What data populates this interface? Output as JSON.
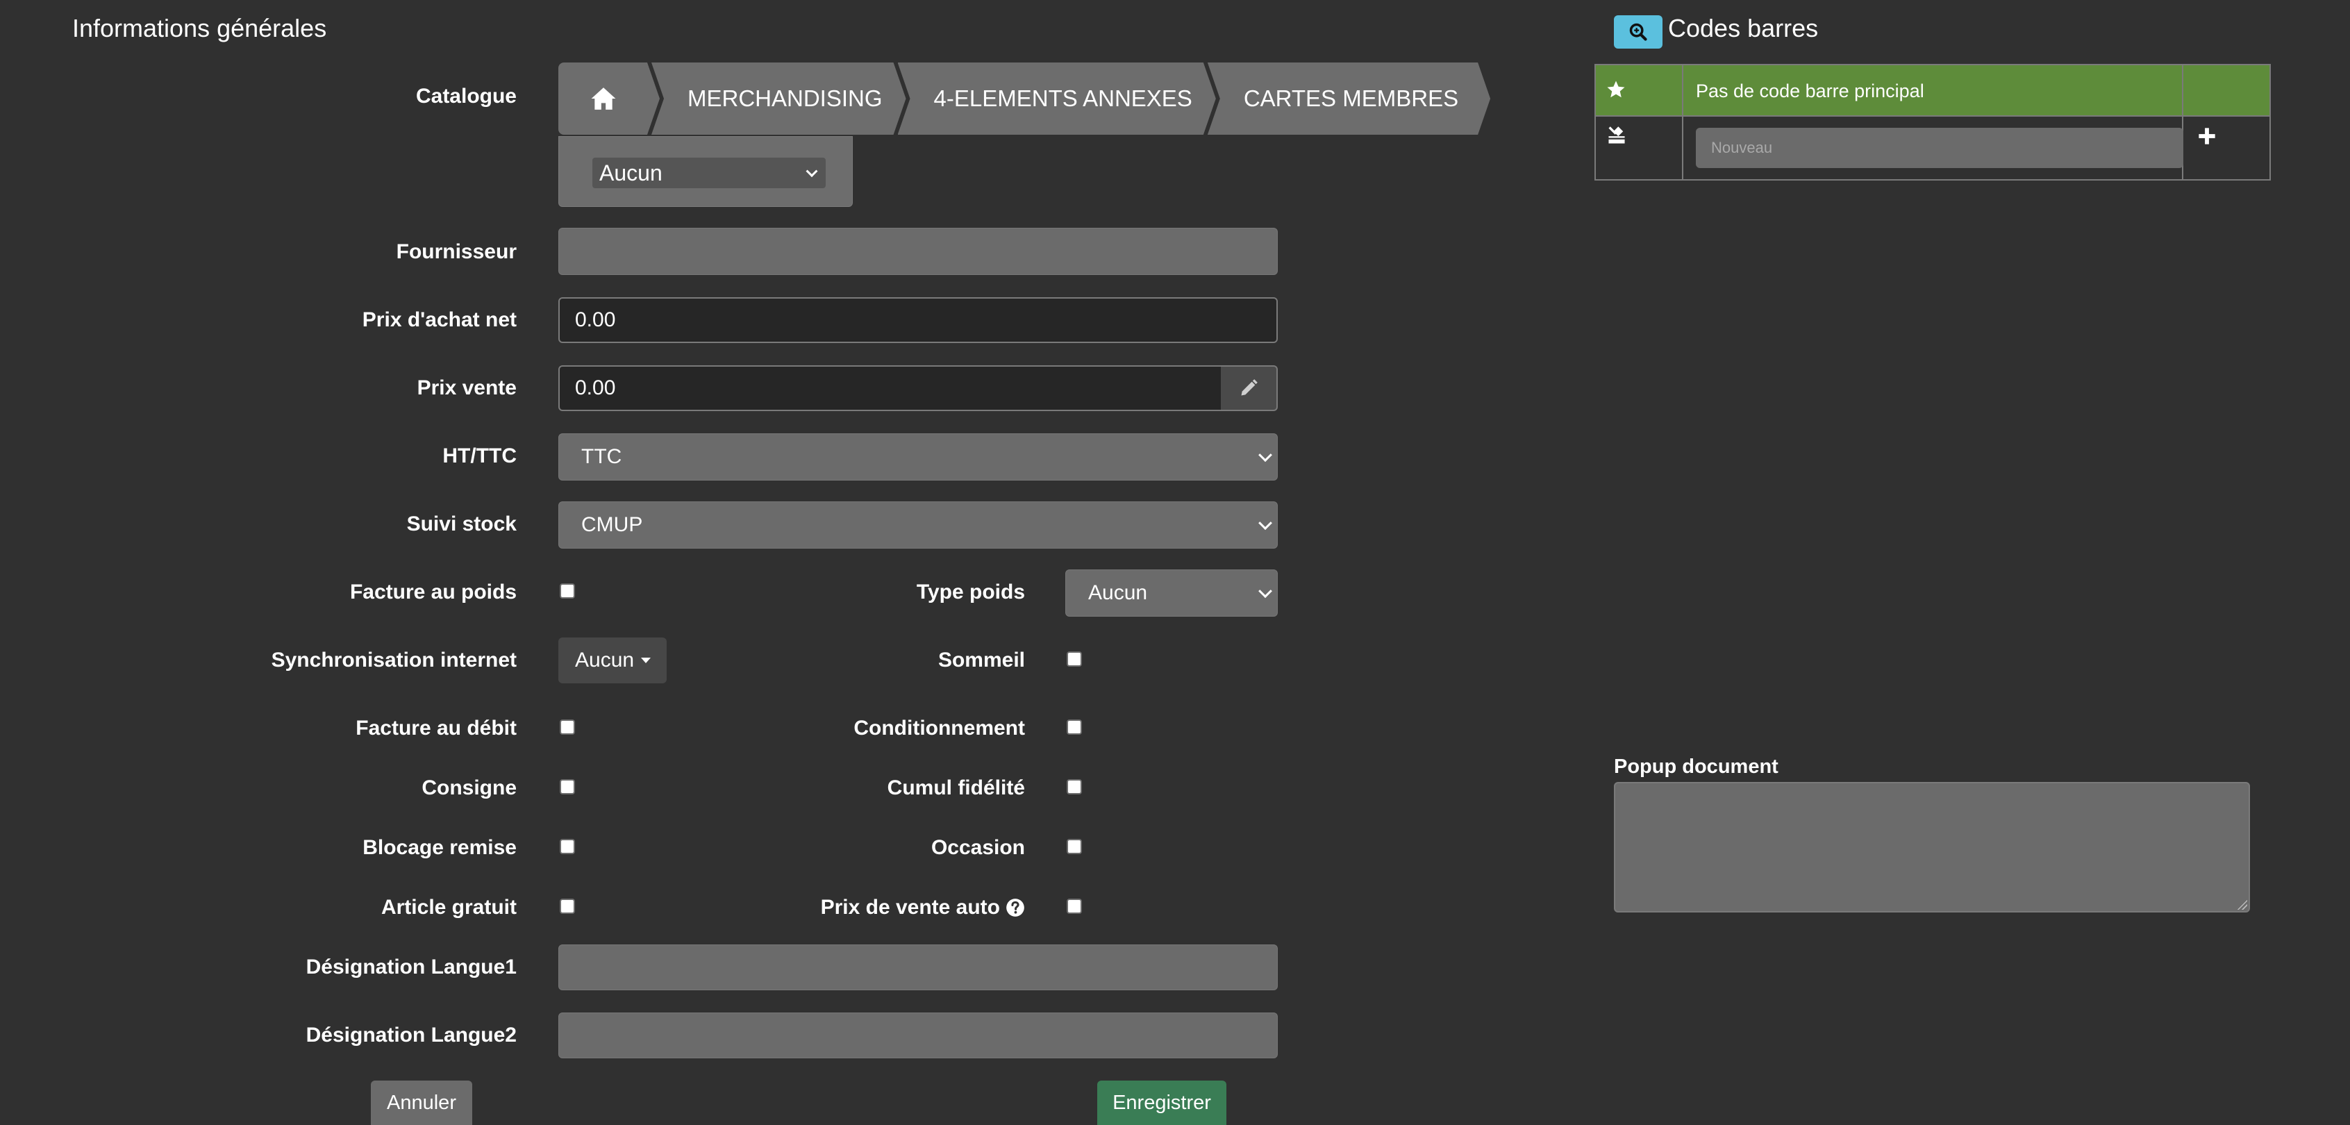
{
  "general": {
    "title": "Informations générales",
    "labels": {
      "catalogue": "Catalogue",
      "fournisseur": "Fournisseur",
      "prix_achat": "Prix d'achat net",
      "prix_vente": "Prix vente",
      "ht_ttc": "HT/TTC",
      "suivi_stock": "Suivi stock",
      "facture_poids": "Facture au poids",
      "type_poids": "Type poids",
      "sync_internet": "Synchronisation internet",
      "sommeil": "Sommeil",
      "facture_debit": "Facture au débit",
      "conditionnement": "Conditionnement",
      "consigne": "Consigne",
      "cumul_fidelite": "Cumul fidélité",
      "blocage_remise": "Blocage remise",
      "occasion": "Occasion",
      "article_gratuit": "Article gratuit",
      "prix_vente_auto": "Prix de vente auto",
      "designation1": "Désignation Langue1",
      "designation2": "Désignation Langue2"
    },
    "breadcrumb": [
      "MERCHANDISING",
      "4-ELEMENTS ANNEXES",
      "CARTES MEMBRES"
    ],
    "catalogue_select": "Aucun",
    "values": {
      "fournisseur": "",
      "prix_achat": "0.00",
      "prix_vente": "0.00",
      "ht_ttc": "TTC",
      "suivi_stock": "CMUP",
      "type_poids": "Aucun",
      "sync_internet": "Aucun",
      "designation1": "",
      "designation2": ""
    },
    "buttons": {
      "cancel": "Annuler",
      "save": "Enregistrer"
    }
  },
  "barcodes": {
    "title": "Codes barres",
    "main_text": "Pas de code barre principal",
    "new_placeholder": "Nouveau"
  },
  "popup": {
    "label": "Popup document",
    "value": ""
  },
  "colors": {
    "background": "#303030",
    "field": "#6b6b6b",
    "save_button": "#3a7d55",
    "barcode_row": "#5e8c3a",
    "search_button": "#5bc0de"
  }
}
